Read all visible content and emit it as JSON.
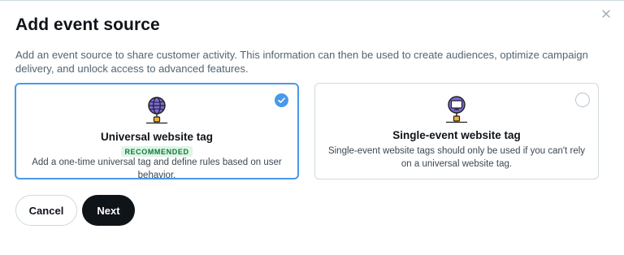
{
  "dialog": {
    "title": "Add event source",
    "description": "Add an event source to share customer activity. This information can then be used to create audiences, optimize campaign delivery, and unlock access to advanced features."
  },
  "options": [
    {
      "title": "Universal website tag",
      "badge": "RECOMMENDED",
      "description": "Add a one-time universal tag and define rules based on user behavior.",
      "selected": true,
      "icon": "globe-network-icon"
    },
    {
      "title": "Single-event website tag",
      "description": "Single-event website tags should only be used if you can't rely on a universal website tag.",
      "selected": false,
      "icon": "monitor-network-icon"
    }
  ],
  "buttons": {
    "cancel": "Cancel",
    "next": "Next"
  },
  "colors": {
    "accent": "#4a99e9",
    "icon_purple": "#7b6ad6",
    "badge_bg": "#dff5e6",
    "badge_text": "#0d7a3b",
    "primary_button": "#0f1419"
  }
}
